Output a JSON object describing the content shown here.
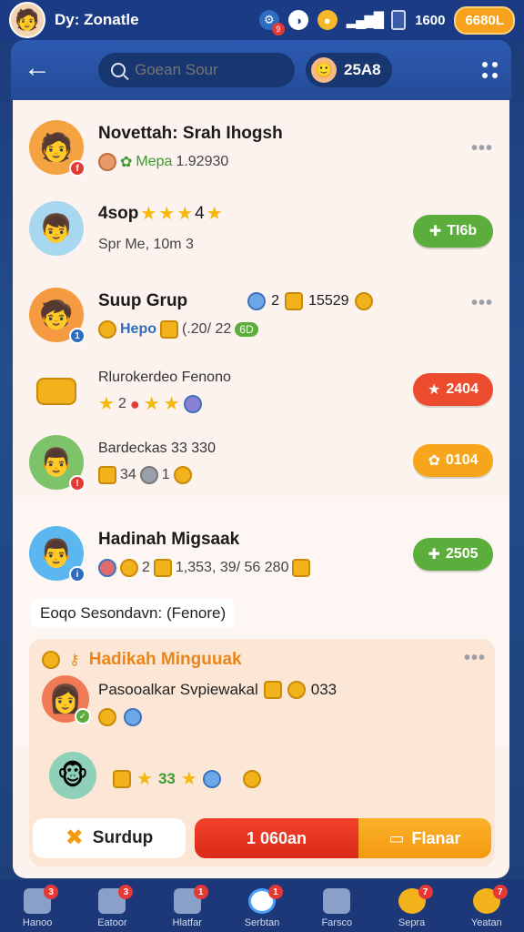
{
  "status": {
    "username": "Dy: Zonatle",
    "notif_count": "9",
    "signal": "▂▄▆█",
    "count": "1600",
    "coins": "6680L"
  },
  "topbar": {
    "search_placeholder": "Goean Sour",
    "profile_value": "25A8"
  },
  "rows": [
    {
      "title": "Novettah: Srah Ihogsh",
      "sub_label": "Mepa",
      "sub_value": "1.92930",
      "badge": "f"
    },
    {
      "title": "4sop",
      "stars_value": "4",
      "sub": "Spr Me, 10m 3",
      "action": "TI6b"
    },
    {
      "title": "Suup Grup",
      "top_value_a": "2",
      "top_value_b": "15529",
      "sub_label": "Hepo",
      "sub_value": "(.20/ 22",
      "sub_tag": "6D",
      "badge": "1"
    },
    {
      "title": "Rlurokerdeo Fenono",
      "sub_value": "2",
      "action": "2404"
    },
    {
      "title": "Bardeckas 33 330",
      "sub_value": "34",
      "sub_value_b": "1",
      "action": "0104"
    },
    {
      "title": "Hadinah Migsaak",
      "sub_value": "2",
      "sub_value_b": "1,353, 39/ 56 280",
      "action": "2505"
    }
  ],
  "section_label": "Eoqo Sesondavn: (Fenore)",
  "reward": {
    "title": "Hadikah Minguuak",
    "desc": "Pasooalkar Svpiewakal",
    "desc_value": "033",
    "stars_value": "33"
  },
  "buttons": {
    "surdup": "Surdup",
    "buy": "1 060an",
    "plan": "Flanar"
  },
  "nav": [
    {
      "label": "Hanoo",
      "badge": "3"
    },
    {
      "label": "Eatoor",
      "badge": "3"
    },
    {
      "label": "Hlatfar",
      "badge": "1"
    },
    {
      "label": "Serbtan",
      "badge": "1"
    },
    {
      "label": "Farsco",
      "badge": ""
    },
    {
      "label": "Sepra",
      "badge": "7"
    },
    {
      "label": "Yeatan",
      "badge": "7"
    }
  ]
}
